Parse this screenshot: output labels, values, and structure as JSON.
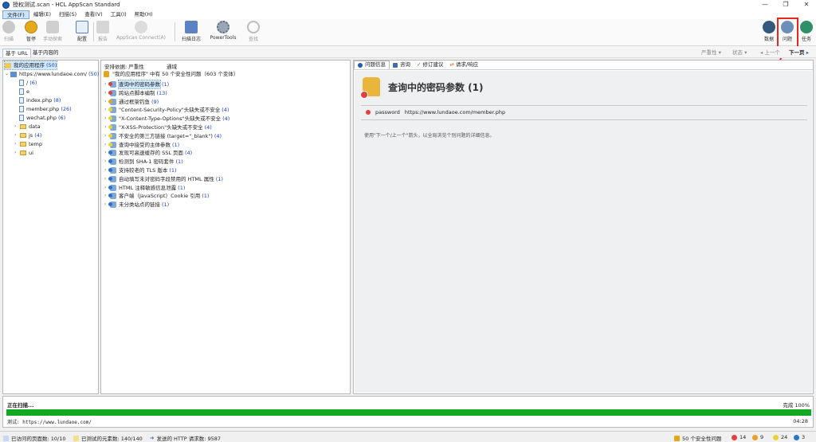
{
  "window": {
    "title": "授权测试.scan - HCL AppScan Standard",
    "minimize": "—",
    "restore": "❐",
    "close": "✕"
  },
  "menu": [
    "文件(F)",
    "编辑(E)",
    "扫描(S)",
    "查看(V)",
    "工具(I)",
    "帮助(H)"
  ],
  "toolbar": {
    "scan": "扫描",
    "pause": "暂停",
    "manual": "手动探索",
    "config": "配置",
    "report": "报告",
    "connect": "AppScan Connect(A)",
    "scanlog": "扫描日志",
    "powertools": "PowerTools",
    "find": "查找",
    "data": "数据",
    "issues": "问题",
    "tasks": "任务"
  },
  "view_tabs": {
    "url": "基于 URL",
    "content": "基于内容的"
  },
  "nav": {
    "severity": "严重性",
    "status": "状态",
    "prev": "上一个",
    "next": "下一页"
  },
  "tree": {
    "root_label": "我的应用程序",
    "root_count": "(50)",
    "site_label": "https://www.lundaoe.com/",
    "site_count": "(50)",
    "items": [
      {
        "label": "/",
        "count": "(6)",
        "kind": "doc"
      },
      {
        "label": "e",
        "count": "",
        "kind": "doc"
      },
      {
        "label": "index.php",
        "count": "(8)",
        "kind": "doc"
      },
      {
        "label": "member.php",
        "count": "(26)",
        "kind": "doc"
      },
      {
        "label": "wechat.php",
        "count": "(6)",
        "kind": "doc"
      },
      {
        "label": "data",
        "count": "",
        "kind": "folder"
      },
      {
        "label": "js",
        "count": "(4)",
        "kind": "folder"
      },
      {
        "label": "temp",
        "count": "",
        "kind": "folder"
      },
      {
        "label": "ui",
        "count": "",
        "kind": "folder"
      }
    ]
  },
  "issues": {
    "header_left": "安排依据: 严重性",
    "header_right": "通域",
    "summary": "\"我的应用程序\" 中有 50 个安全性问题（603 个变体）",
    "list": [
      {
        "label": "查询中的密码参数",
        "count": "(1)",
        "sev": "h"
      },
      {
        "label": "跨站点脚本编制",
        "count": "(13)",
        "sev": "h"
      },
      {
        "label": "通过框架钓鱼",
        "count": "(9)",
        "sev": "m"
      },
      {
        "label": "\"Content-Security-Policy\"头缺失或不安全",
        "count": "(4)",
        "sev": "l"
      },
      {
        "label": "\"X-Content-Type-Options\"头缺失或不安全",
        "count": "(4)",
        "sev": "l"
      },
      {
        "label": "\"X-XSS-Protection\"头缺失或不安全",
        "count": "(4)",
        "sev": "l"
      },
      {
        "label": "不安全的第三方链接 (target=\"_blank\")",
        "count": "(4)",
        "sev": "l"
      },
      {
        "label": "查询中接受的主体参数",
        "count": "(1)",
        "sev": "l"
      },
      {
        "label": "发现可高速缓存的 SSL 页面",
        "count": "(4)",
        "sev": "i"
      },
      {
        "label": "检测到 SHA-1 密码套件",
        "count": "(1)",
        "sev": "i"
      },
      {
        "label": "支持较老的 TLS 版本",
        "count": "(1)",
        "sev": "i"
      },
      {
        "label": "自动填写未对密码字段禁用的 HTML 属性",
        "count": "(1)",
        "sev": "i"
      },
      {
        "label": "HTML 注释敏感信息泄露",
        "count": "(1)",
        "sev": "i"
      },
      {
        "label": "客户端（JavaScript）Cookie 引用",
        "count": "(1)",
        "sev": "i"
      },
      {
        "label": "未分类站点的链接",
        "count": "(1)",
        "sev": "i"
      }
    ]
  },
  "detail": {
    "tabs": [
      "问题信息",
      "咨询",
      "修订建议",
      "请求/响应"
    ],
    "title": "查询中的密码参数 (1)",
    "param_name": "password",
    "param_url": "https://www.lundaoe.com/member.php",
    "hint": "使用\"下一个/上一个\"箭头，以全局浏览个别问题的详细信息。"
  },
  "progress": {
    "label": "正在扫描...",
    "complete": "完成 100%",
    "percent": 100,
    "testing": "测试: https://www.lundaoe.com/",
    "elapsed": "04:28"
  },
  "status": {
    "visited": "已访问的页面数: 10/10",
    "tested": "已测试的元素数: 140/140",
    "requests": "发送的 HTTP 请求数: 9587",
    "total": "50 个安全性问题",
    "high": "14",
    "medium": "9",
    "low": "24",
    "info": "3"
  },
  "colors": {
    "accent": "#1e5fb0",
    "progress": "#12a824",
    "callout": "#e8261e",
    "high": "#e24040",
    "medium": "#e6a22a",
    "low": "#e8d435",
    "info": "#2a74c8"
  }
}
